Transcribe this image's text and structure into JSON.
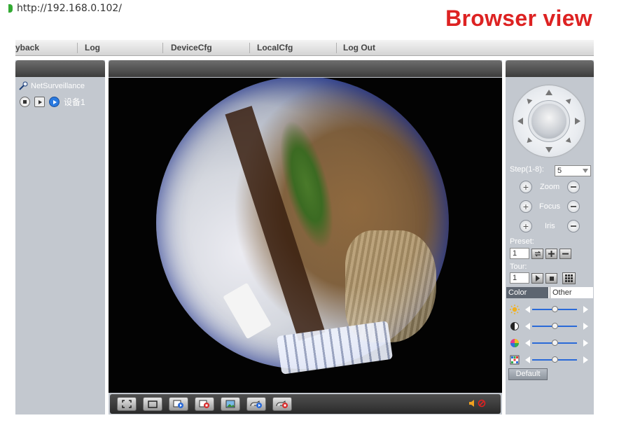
{
  "browser": {
    "url": "http://192.168.0.102/",
    "annotation": "Browser view",
    "annotation_color": "#dd2222"
  },
  "menu": {
    "items": [
      "yback",
      "Log",
      "DeviceCfg",
      "LocalCfg",
      "Log Out"
    ]
  },
  "device_tree": {
    "root": "NetSurveillance",
    "device": "设备1"
  },
  "video_toolbar": {
    "buttons": [
      "fullscreen-icon",
      "window-layout-icon",
      "record-icon",
      "stop-record-icon",
      "snapshot-icon",
      "playback-icon",
      "stop-playback-icon"
    ],
    "audio": [
      "speaker-icon",
      "mute-icon"
    ]
  },
  "ptz": {
    "step_label": "Step(1-8):",
    "step_value": "5",
    "zoom_label": "Zoom",
    "focus_label": "Focus",
    "iris_label": "Iris",
    "preset_label": "Preset:",
    "preset_value": "1",
    "tour_label": "Tour:",
    "tour_value": "1"
  },
  "color_tabs": {
    "color": "Color",
    "other": "Other"
  },
  "color_sliders": [
    {
      "icon": "brightness-icon",
      "value": 0.5
    },
    {
      "icon": "contrast-icon",
      "value": 0.5
    },
    {
      "icon": "saturation-icon",
      "value": 0.5
    },
    {
      "icon": "hue-icon",
      "value": 0.5
    }
  ],
  "default_label": "Default",
  "colors": {
    "panel": "#c3c8cf",
    "panel_header": "#3c3c3c",
    "slider_track": "#2a6ad8"
  }
}
